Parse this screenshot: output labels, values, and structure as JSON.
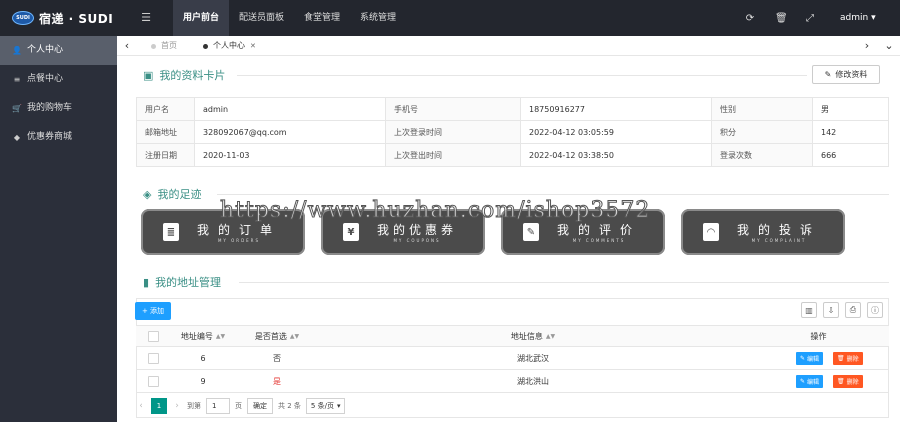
{
  "brand": {
    "badge": "SUDI",
    "name": "宿递 · SUDI"
  },
  "topnav": {
    "toggle_icon": "menu-icon",
    "items": [
      {
        "label": "用户前台",
        "active": true
      },
      {
        "label": "配送员面板"
      },
      {
        "label": "食堂管理"
      },
      {
        "label": "系统管理"
      }
    ],
    "icons": [
      "refresh-icon",
      "trash-icon",
      "fullscreen-icon"
    ],
    "user": "admin"
  },
  "sidebar": {
    "items": [
      {
        "label": "个人中心",
        "icon": "user-icon",
        "active": true
      },
      {
        "label": "点餐中心",
        "icon": "list-icon"
      },
      {
        "label": "我的购物车",
        "icon": "cart-icon"
      },
      {
        "label": "优惠券商城",
        "icon": "tag-icon"
      }
    ]
  },
  "tabs": {
    "home": "首页",
    "current": "个人中心"
  },
  "profile": {
    "title": "我的资料卡片",
    "edit_label": "修改资料",
    "rows": [
      [
        "用户名",
        "admin",
        "手机号",
        "18750916277",
        "性别",
        "男"
      ],
      [
        "邮箱地址",
        "328092067@qq.com",
        "上次登录时间",
        "2022-04-12 03:05:59",
        "积分",
        "142"
      ],
      [
        "注册日期",
        "2020-11-03",
        "上次登出时间",
        "2022-04-12 03:38:50",
        "登录次数",
        "666"
      ]
    ]
  },
  "footprint": {
    "title": "我的足迹",
    "buttons": [
      {
        "main": "我的订单",
        "sub": "MY ORDERS",
        "icon": "document-icon"
      },
      {
        "main": "我的优惠券",
        "sub": "MY COUPONS",
        "icon": "coupon-icon"
      },
      {
        "main": "我的评价",
        "sub": "MY COMMENTS",
        "icon": "edit-icon"
      },
      {
        "main": "我的投诉",
        "sub": "MY COMPLAINT",
        "icon": "chat-icon"
      }
    ]
  },
  "watermark": "https://www.huzhan.com/ishop3572",
  "address": {
    "title": "我的地址管理",
    "add_label": "+ 添加",
    "columns": [
      "地址编号",
      "是否首选",
      "地址信息",
      "操作"
    ],
    "rows": [
      {
        "id": "6",
        "preferred": "否",
        "info": "湖北武汉"
      },
      {
        "id": "9",
        "preferred": "是",
        "info": "湖北洪山"
      }
    ],
    "edit_label": "编辑",
    "delete_label": "删除",
    "pager": {
      "current": "1",
      "goto_label": "到第",
      "page_input": "1",
      "page_suffix": "页",
      "confirm": "确定",
      "total": "共 2 条",
      "per_page": "5 条/页"
    }
  }
}
